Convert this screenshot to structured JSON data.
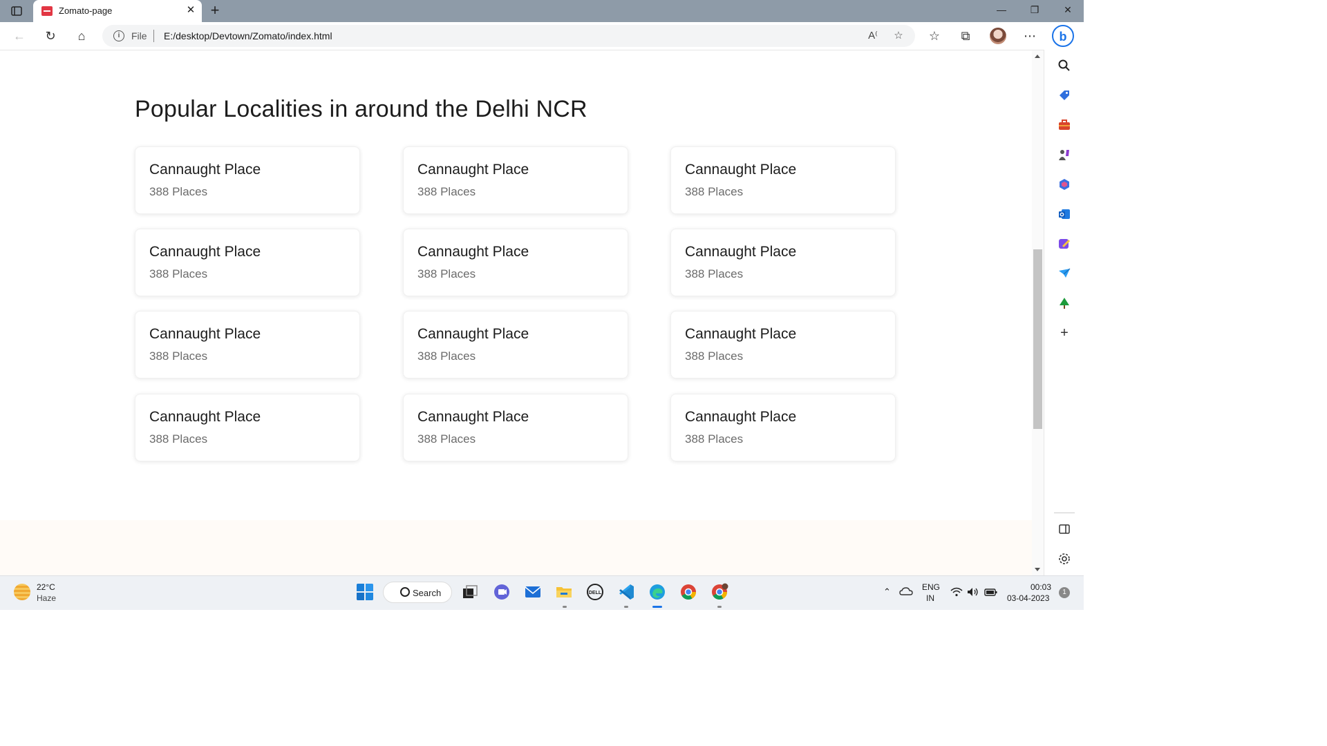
{
  "browser": {
    "tab_title": "Zomato-page",
    "tab_close": "✕",
    "new_tab": "+",
    "address_scheme": "File",
    "address_url": "E:/desktop/Devtown/Zomato/index.html"
  },
  "page": {
    "heading": "Popular Localities in around the Delhi NCR",
    "localities": [
      {
        "name": "Cannaught Place",
        "count": "388 Places"
      },
      {
        "name": "Cannaught Place",
        "count": "388 Places"
      },
      {
        "name": "Cannaught Place",
        "count": "388 Places"
      },
      {
        "name": "Cannaught Place",
        "count": "388 Places"
      },
      {
        "name": "Cannaught Place",
        "count": "388 Places"
      },
      {
        "name": "Cannaught Place",
        "count": "388 Places"
      },
      {
        "name": "Cannaught Place",
        "count": "388 Places"
      },
      {
        "name": "Cannaught Place",
        "count": "388 Places"
      },
      {
        "name": "Cannaught Place",
        "count": "388 Places"
      },
      {
        "name": "Cannaught Place",
        "count": "388 Places"
      },
      {
        "name": "Cannaught Place",
        "count": "388 Places"
      },
      {
        "name": "Cannaught Place",
        "count": "388 Places"
      }
    ]
  },
  "taskbar": {
    "weather_temp": "22°C",
    "weather_condition": "Haze",
    "search_label": "Search",
    "lang_primary": "ENG",
    "lang_secondary": "IN",
    "time": "00:03",
    "date": "03-04-2023",
    "notification_count": "1"
  },
  "colors": {
    "zomato_red": "#e23744",
    "titlebar": "#8e9ba8",
    "edge_blue": "#1a73e8"
  }
}
